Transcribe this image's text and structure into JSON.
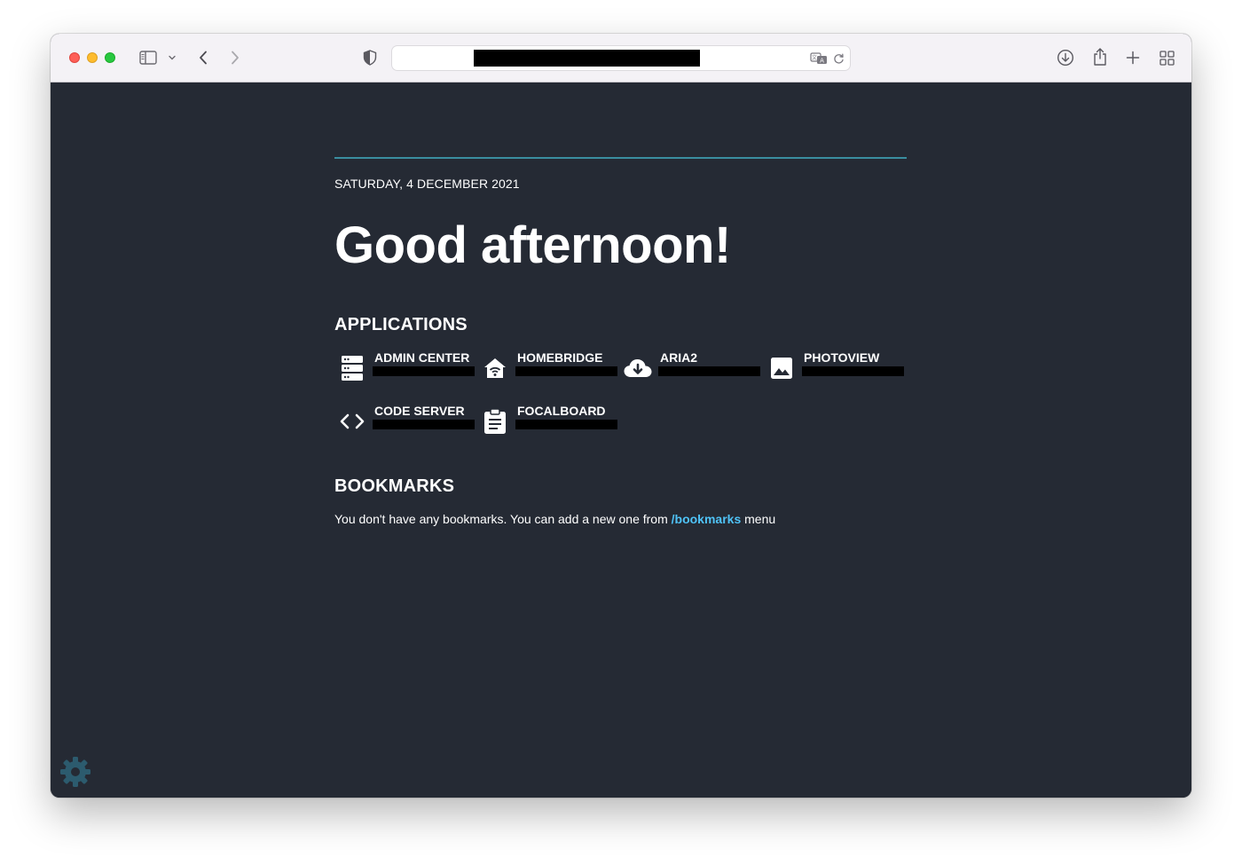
{
  "browser": {
    "address_redacted": true,
    "toolbar_icons": [
      "sidebar-icon",
      "chevron-down-icon",
      "back-icon",
      "forward-icon",
      "privacy-shield-icon",
      "translate-icon",
      "reload-icon",
      "download-icon",
      "share-icon",
      "new-tab-icon",
      "tab-overview-icon"
    ]
  },
  "page": {
    "date": "SATURDAY, 4 DECEMBER 2021",
    "greeting": "Good afternoon!",
    "accent_color": "#3a8ea0",
    "background_color": "#252a34",
    "link_color": "#4fc3f7"
  },
  "applications": {
    "title": "APPLICATIONS",
    "items": [
      {
        "label": "ADMIN CENTER",
        "icon": "server-icon"
      },
      {
        "label": "HOMEBRIDGE",
        "icon": "home-wifi-icon"
      },
      {
        "label": "ARIA2",
        "icon": "cloud-download-icon"
      },
      {
        "label": "PHOTOVIEW",
        "icon": "image-icon"
      },
      {
        "label": "CODE SERVER",
        "icon": "code-icon"
      },
      {
        "label": "FOCALBOARD",
        "icon": "clipboard-icon"
      }
    ]
  },
  "bookmarks": {
    "title": "BOOKMARKS",
    "text_before": "You don't have any bookmarks. You can add a new one from ",
    "link": "/bookmarks",
    "text_after": " menu"
  },
  "settings": {
    "icon": "gear-icon"
  }
}
